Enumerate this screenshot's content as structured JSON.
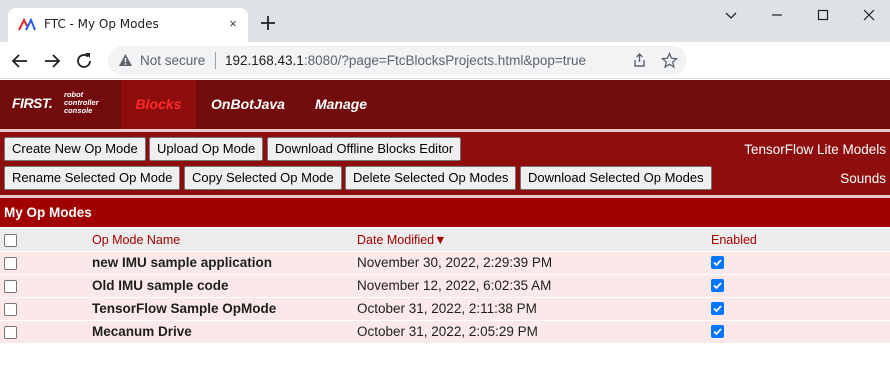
{
  "browser": {
    "tab_title": "FTC - My Op Modes",
    "tab_close_icon": "×",
    "security_label": "Not secure",
    "url_host": "192.168.43.1",
    "url_rest": ":8080/?page=FtcBlocksProjects.html&pop=true"
  },
  "header": {
    "logo_first": "FIRST.",
    "logo_sub_1": "robot",
    "logo_sub_2": "controller",
    "logo_sub_3": "console",
    "nav": [
      "Blocks",
      "OnBotJava",
      "Manage"
    ],
    "active_nav": "Blocks"
  },
  "toolbar": {
    "row1": [
      "Create New Op Mode",
      "Upload Op Mode",
      "Download Offline Blocks Editor"
    ],
    "row2": [
      "Rename Selected Op Mode",
      "Copy Selected Op Mode",
      "Delete Selected Op Modes",
      "Download Selected Op Modes"
    ],
    "link_tensorflow": "TensorFlow Lite Models",
    "link_sounds": "Sounds"
  },
  "section": {
    "title": "My Op Modes",
    "columns": {
      "name": "Op Mode Name",
      "date": "Date Modified▼",
      "enabled": "Enabled"
    },
    "rows": [
      {
        "name": "new IMU sample application",
        "date": "November 30, 2022, 2:29:39 PM",
        "enabled": true,
        "selected": false
      },
      {
        "name": "Old IMU sample code",
        "date": "November 12, 2022, 6:02:35 AM",
        "enabled": true,
        "selected": false
      },
      {
        "name": "TensorFlow Sample OpMode",
        "date": "October 31, 2022, 2:11:38 PM",
        "enabled": true,
        "selected": false
      },
      {
        "name": "Mecanum Drive",
        "date": "October 31, 2022, 2:05:29 PM",
        "enabled": true,
        "selected": false
      }
    ]
  },
  "colors": {
    "header_bg": "#720c0c",
    "toolbar_bg": "#8e0d0d",
    "section_bg": "#a00000",
    "active_nav_text": "#ff2b2b",
    "row_bg": "#fbe9e9",
    "checkbox_blue": "#0075ff"
  },
  "icons": [
    "ftc-favicon",
    "close-icon",
    "plus-icon",
    "minimize-icon",
    "maximize-icon",
    "close-window-icon",
    "chevron-down-icon",
    "back-arrow-icon",
    "forward-arrow-icon",
    "reload-icon",
    "warning-icon",
    "share-icon",
    "star-icon",
    "checkmark-icon"
  ]
}
